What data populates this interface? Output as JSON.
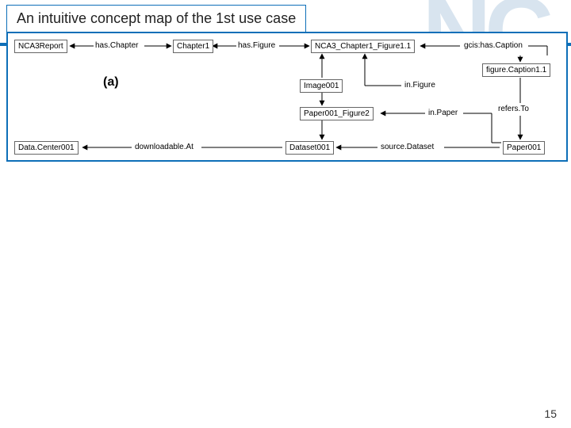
{
  "title": "An intuitive concept map of the 1st use case",
  "bg_letters": "NC",
  "page_number": "15",
  "sublabel": "(a)",
  "nodes": {
    "nca3report": "NCA3Report",
    "chapter1": "Chapter1",
    "nca3fig": "NCA3_Chapter1_Figure1.1",
    "caption": "figure.Caption1.1",
    "image001": "Image001",
    "paperfig": "Paper001_Figure2",
    "paper001": "Paper001",
    "dataset": "Dataset001",
    "datacenter": "Data.Center001"
  },
  "edges": {
    "hasChapter": "has.Chapter",
    "hasFigure": "has.Figure",
    "gcisCaption": "gcis:has.Caption",
    "inFigure": "in.Figure",
    "inPaper": "in.Paper",
    "refersTo": "refers.To",
    "sourceDataset": "source.Dataset",
    "downloadableAt": "downloadable.At"
  }
}
